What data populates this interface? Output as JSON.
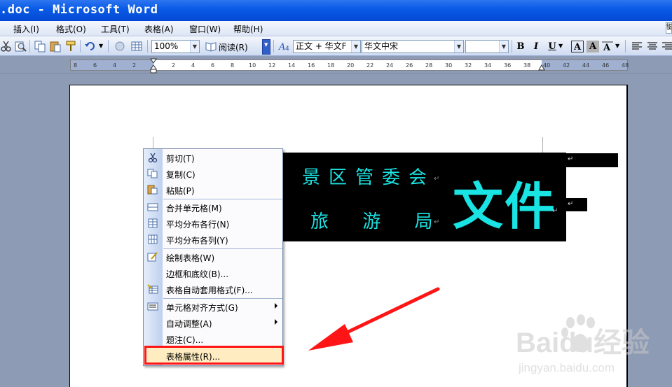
{
  "window": {
    "title": ".doc - Microsoft Word"
  },
  "menubar": {
    "items": [
      "插入(I)",
      "格式(O)",
      "工具(T)",
      "表格(A)",
      "窗口(W)",
      "帮助(H)"
    ],
    "edge_text": "键"
  },
  "toolbar": {
    "zoom": "100%",
    "read_label": "阅读(R)",
    "style_value": "正文 + 华文F",
    "font_value": "华文中宋",
    "size_value": "",
    "bold_label": "B",
    "italic_label": "I",
    "underline_label": "U",
    "font_color_label": "A",
    "char_shading_label": "A",
    "icons": [
      "cut-icon",
      "copy-icon",
      "paste-icon",
      "format-painter-icon",
      "undo-icon",
      "hyperlink-icon",
      "table-icon",
      "styles-icon",
      "align-left-icon",
      "center-icon"
    ]
  },
  "ruler": {
    "labels": [
      "8",
      "6",
      "4",
      "2",
      "",
      "2",
      "4",
      "6",
      "8",
      "10",
      "12",
      "14",
      "16",
      "18",
      "20",
      "22",
      "24",
      "26",
      "28",
      "30",
      "32",
      "34",
      "36",
      "38",
      "40",
      "42",
      "44",
      "46",
      "48"
    ]
  },
  "document": {
    "line1": "景区管委会",
    "line2": "旅 游 局",
    "big_text": "文件",
    "para_mark": "↵"
  },
  "context_menu": {
    "items": [
      {
        "label": "剪切(T)",
        "icon": "scissors-icon"
      },
      {
        "label": "复制(C)",
        "icon": "copy-icon"
      },
      {
        "label": "粘贴(P)",
        "icon": "paste-icon"
      },
      {
        "label": "合并单元格(M)",
        "icon": "merge-cells-icon"
      },
      {
        "label": "平均分布各行(N)",
        "icon": "distribute-rows-icon"
      },
      {
        "label": "平均分布各列(Y)",
        "icon": "distribute-columns-icon"
      },
      {
        "label": "绘制表格(W)",
        "icon": "draw-table-icon"
      },
      {
        "label": "边框和底纹(B)...",
        "icon": ""
      },
      {
        "label": "表格自动套用格式(F)...",
        "icon": "table-autoformat-icon"
      },
      {
        "label": "单元格对齐方式(G)",
        "icon": "cell-alignment-icon"
      },
      {
        "label": "自动调整(A)",
        "icon": ""
      },
      {
        "label": "题注(C)...",
        "icon": ""
      },
      {
        "label": "表格属性(R)...",
        "icon": ""
      }
    ]
  },
  "watermark": {
    "brand": "Baidu经验",
    "url": "jingyan.baidu.com"
  },
  "colors": {
    "accent": "#19e3e3",
    "highlight_box": "#ff1515",
    "title_bar": "#0a5ce6"
  }
}
